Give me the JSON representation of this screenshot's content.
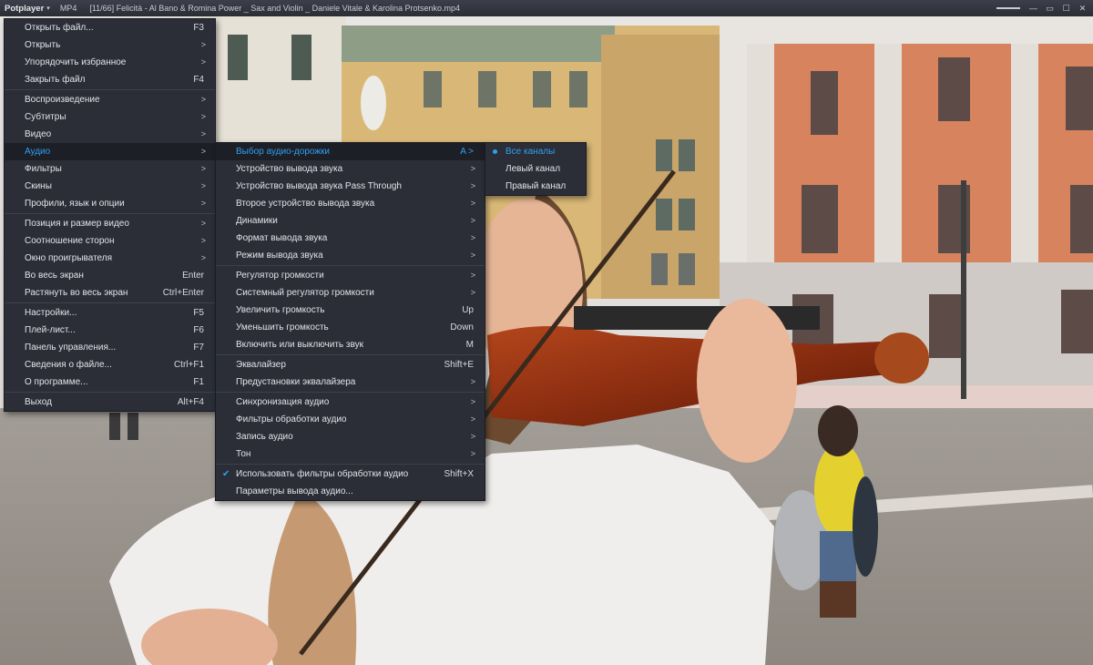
{
  "titlebar": {
    "app_name": "Potplayer",
    "format": "MP4",
    "file_title": "[11/66] Felicità - Al Bano & Romina Power _ Sax and Violin _ Daniele Vitale & Karolina Protsenko.mp4",
    "controls": [
      "minimize-icon",
      "restore-icon",
      "maximize-icon",
      "close-icon"
    ]
  },
  "main_menu": {
    "items": [
      {
        "label": "Открыть файл...",
        "shortcut": "F3"
      },
      {
        "label": "Открыть",
        "submenu": true
      },
      {
        "label": "Упорядочить избранное",
        "submenu": true
      },
      {
        "label": "Закрыть файл",
        "shortcut": "F4"
      },
      {
        "label": "Воспроизведение",
        "submenu": true
      },
      {
        "label": "Субтитры",
        "submenu": true
      },
      {
        "label": "Видео",
        "submenu": true
      },
      {
        "label": "Аудио",
        "submenu": true,
        "active": true
      },
      {
        "label": "Фильтры",
        "submenu": true
      },
      {
        "label": "Скины",
        "submenu": true
      },
      {
        "label": "Профили, язык и опции",
        "submenu": true
      },
      {
        "label": "Позиция и размер видео",
        "submenu": true
      },
      {
        "label": "Соотношение сторон",
        "submenu": true
      },
      {
        "label": "Окно проигрывателя",
        "submenu": true
      },
      {
        "label": "Во весь экран",
        "shortcut": "Enter"
      },
      {
        "label": "Растянуть во весь экран",
        "shortcut": "Ctrl+Enter"
      },
      {
        "label": "Настройки...",
        "shortcut": "F5"
      },
      {
        "label": "Плей-лист...",
        "shortcut": "F6"
      },
      {
        "label": "Панель управления...",
        "shortcut": "F7"
      },
      {
        "label": "Сведения о файле...",
        "shortcut": "Ctrl+F1"
      },
      {
        "label": "О программе...",
        "shortcut": "F1"
      },
      {
        "label": "Выход",
        "shortcut": "Alt+F4"
      }
    ]
  },
  "audio_menu": {
    "items": [
      {
        "label": "Выбор аудио-дорожки",
        "shortcut": "A >",
        "active": true
      },
      {
        "label": "Устройство вывода звука",
        "submenu": true
      },
      {
        "label": "Устройство вывода звука Pass Through",
        "submenu": true
      },
      {
        "label": "Второе устройство вывода звука",
        "submenu": true
      },
      {
        "label": "Динамики",
        "submenu": true
      },
      {
        "label": "Формат вывода звука",
        "submenu": true
      },
      {
        "label": "Режим вывода звука",
        "submenu": true
      },
      {
        "label": "Регулятор громкости",
        "submenu": true
      },
      {
        "label": "Системный регулятор громкости",
        "submenu": true
      },
      {
        "label": "Увеличить громкость",
        "shortcut": "Up"
      },
      {
        "label": "Уменьшить громкость",
        "shortcut": "Down"
      },
      {
        "label": "Включить или выключить звук",
        "shortcut": "M"
      },
      {
        "label": "Эквалайзер",
        "shortcut": "Shift+E"
      },
      {
        "label": "Предустановки эквалайзера",
        "submenu": true
      },
      {
        "label": "Синхронизация аудио",
        "submenu": true
      },
      {
        "label": "Фильтры обработки аудио",
        "submenu": true
      },
      {
        "label": "Запись аудио",
        "submenu": true
      },
      {
        "label": "Тон",
        "submenu": true
      },
      {
        "label": "Использовать фильтры обработки аудио",
        "shortcut": "Shift+X",
        "checked": true
      },
      {
        "label": "Параметры вывода аудио..."
      }
    ]
  },
  "track_menu": {
    "items": [
      {
        "label": "Все каналы",
        "selected": true
      },
      {
        "label": "Левый канал"
      },
      {
        "label": "Правый канал"
      }
    ]
  },
  "submenu_arrow": ">",
  "check_glyph": "✔",
  "colors": {
    "accent": "#2fa0f0",
    "menu_bg": "#2b2e37",
    "title_bg": "#2c2e36"
  }
}
